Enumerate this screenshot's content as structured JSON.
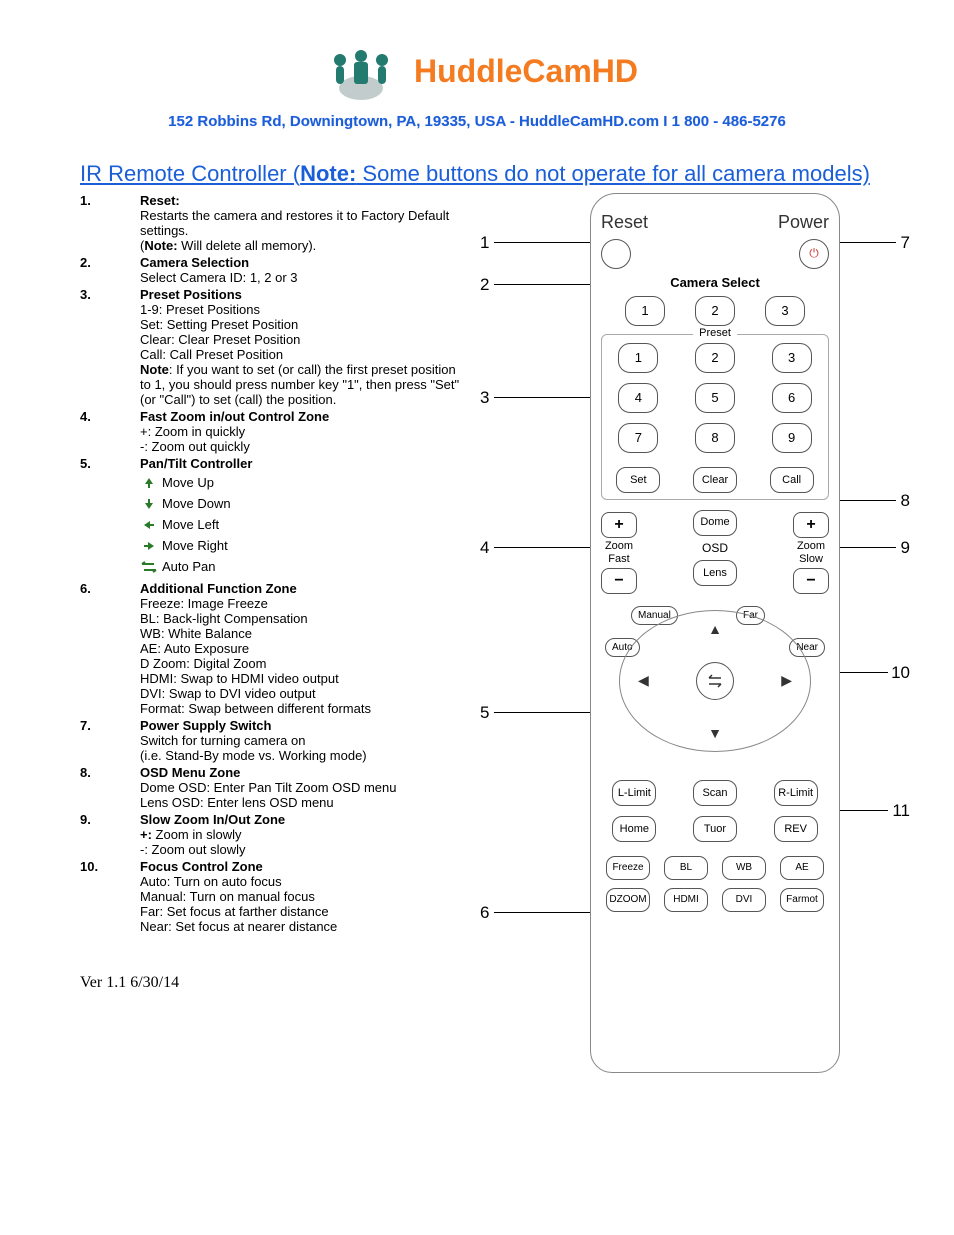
{
  "brand": "HuddleCamHD",
  "address": "152 Robbins Rd, Downingtown, PA, 19335, USA - HuddleCamHD.com I 1 800 - 486-5276",
  "section_title_a": "IR Remote Controller (",
  "section_title_note": "Note:",
  "section_title_b": " Some buttons do not operate for all camera models)",
  "version": "Ver 1.1 6/30/14",
  "items": [
    {
      "num": "1.",
      "heading": "Reset:",
      "desc": "Restarts the camera and restores it to Factory Default settings.",
      "note_label": "Note:",
      "note_rest": " Will delete all memory)."
    },
    {
      "num": "2.",
      "heading": "Camera Selection",
      "desc": "Select Camera ID: 1, 2 or 3"
    },
    {
      "num": "3.",
      "heading": "Preset Positions",
      "lines": [
        "1-9: Preset Positions",
        "Set: Setting Preset Position",
        "Clear: Clear Preset Position",
        "Call: Call Preset Position"
      ],
      "note_label": "Note",
      "note_rest": ": If you want to set (or call) the first preset position to 1, you should press number key \"1\", then press \"Set\" (or \"Call\") to set (call) the position."
    },
    {
      "num": "4.",
      "heading": "Fast Zoom in/out Control Zone",
      "lines": [
        "+: Zoom in quickly",
        "-: Zoom out quickly"
      ]
    },
    {
      "num": "5.",
      "heading": "Pan/Tilt Controller",
      "pantilt": [
        "Move Up",
        "Move Down",
        "Move Left",
        "Move Right",
        "Auto Pan"
      ]
    },
    {
      "num": "6.",
      "heading": "Additional Function Zone",
      "lines": [
        "Freeze: Image Freeze",
        "BL: Back-light Compensation",
        "WB: White Balance",
        "AE: Auto Exposure",
        "D Zoom: Digital Zoom",
        "HDMI: Swap to HDMI video output",
        "DVI: Swap to DVI video output",
        "Format: Swap between different formats"
      ]
    },
    {
      "num": "7.",
      "heading": "Power Supply Switch",
      "lines": [
        "Switch for turning camera on",
        "(i.e. Stand-By mode vs. Working mode)"
      ]
    },
    {
      "num": "8.",
      "heading": "OSD Menu Zone",
      "lines": [
        "Dome OSD: Enter Pan Tilt Zoom OSD menu",
        "Lens OSD: Enter lens OSD menu"
      ]
    },
    {
      "num": "9.",
      "heading": "Slow Zoom In/Out Zone",
      "lines_bold_first": [
        "+:|Zoom in slowly",
        " -: Zoom out slowly"
      ]
    },
    {
      "num": "10.",
      "heading": "Focus Control Zone",
      "lines": [
        "Auto: Turn on auto focus",
        "Manual: Turn on manual focus",
        "Far: Set focus at farther distance",
        "Near: Set focus at nearer distance"
      ]
    }
  ],
  "remote": {
    "reset": "Reset",
    "power": "Power",
    "camera_select": "Camera Select",
    "cam": [
      "1",
      "2",
      "3"
    ],
    "preset_label": "Preset",
    "presets": [
      "1",
      "2",
      "3",
      "4",
      "5",
      "6",
      "7",
      "8",
      "9"
    ],
    "set": "Set",
    "clear": "Clear",
    "call": "Call",
    "zoom": "Zoom",
    "fast": "Fast",
    "slow": "Slow",
    "dome": "Dome",
    "osd": "OSD",
    "lens": "Lens",
    "manual": "Manual",
    "far": "Far",
    "auto": "Auto",
    "near": "Near",
    "llimit": "L-Limit",
    "scan": "Scan",
    "rlimit": "R-Limit",
    "home": "Home",
    "tuor": "Tuor",
    "rev": "REV",
    "freeze": "Freeze",
    "bl": "BL",
    "wb": "WB",
    "ae": "AE",
    "dzoom": "DZOOM",
    "hdmi": "HDMI",
    "dvi": "DVI",
    "farmot": "Farmot"
  },
  "callouts_left": [
    "1",
    "2",
    "3",
    "4",
    "5",
    "6"
  ],
  "callouts_right": [
    "7",
    "8",
    "9",
    "10",
    "11"
  ]
}
